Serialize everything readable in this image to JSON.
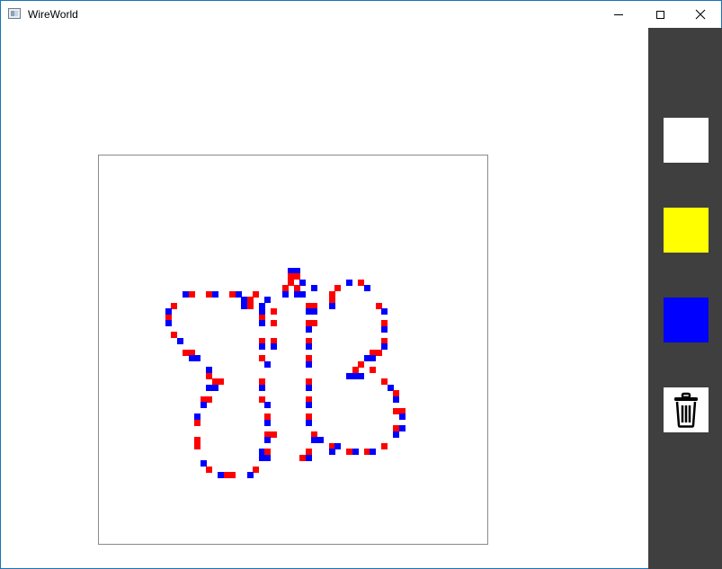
{
  "window": {
    "title": "WireWorld"
  },
  "palette": {
    "colors": {
      "empty": "#ffffff",
      "conductor": "#ffff00",
      "electron_head": "#0000ff",
      "electron_tail": "#ff0000"
    },
    "tools": [
      {
        "name": "empty-cell-tool",
        "color": "#ffffff"
      },
      {
        "name": "conductor-tool",
        "color": "#ffff00"
      },
      {
        "name": "electron-head-tool",
        "color": "#0000ff"
      },
      {
        "name": "clear-grid-tool",
        "icon": "trash-icon"
      }
    ]
  },
  "grid": {
    "cells": [
      {
        "c": "b",
        "x": 32,
        "y": 19
      },
      {
        "c": "b",
        "x": 33,
        "y": 19
      },
      {
        "c": "r",
        "x": 32,
        "y": 20
      },
      {
        "c": "r",
        "x": 33,
        "y": 20
      },
      {
        "c": "r",
        "x": 32,
        "y": 21
      },
      {
        "c": "b",
        "x": 34,
        "y": 21
      },
      {
        "c": "r",
        "x": 31,
        "y": 22
      },
      {
        "c": "r",
        "x": 33,
        "y": 22
      },
      {
        "c": "b",
        "x": 31,
        "y": 23
      },
      {
        "c": "b",
        "x": 33,
        "y": 23
      },
      {
        "c": "b",
        "x": 34,
        "y": 23
      },
      {
        "c": "b",
        "x": 42,
        "y": 21
      },
      {
        "c": "r",
        "x": 44,
        "y": 21
      },
      {
        "c": "b",
        "x": 45,
        "y": 22
      },
      {
        "c": "r",
        "x": 40,
        "y": 22
      },
      {
        "c": "b",
        "x": 36,
        "y": 22
      },
      {
        "c": "r",
        "x": 39,
        "y": 23
      },
      {
        "c": "b",
        "x": 14,
        "y": 23
      },
      {
        "c": "r",
        "x": 15,
        "y": 23
      },
      {
        "c": "r",
        "x": 18,
        "y": 23
      },
      {
        "c": "b",
        "x": 19,
        "y": 23
      },
      {
        "c": "r",
        "x": 22,
        "y": 23
      },
      {
        "c": "b",
        "x": 23,
        "y": 23
      },
      {
        "c": "r",
        "x": 26,
        "y": 23
      },
      {
        "c": "b",
        "x": 24,
        "y": 24
      },
      {
        "c": "r",
        "x": 25,
        "y": 24
      },
      {
        "c": "b",
        "x": 28,
        "y": 24
      },
      {
        "c": "b",
        "x": 24,
        "y": 25
      },
      {
        "c": "r",
        "x": 25,
        "y": 25
      },
      {
        "c": "b",
        "x": 27,
        "y": 25
      },
      {
        "c": "r",
        "x": 35,
        "y": 25
      },
      {
        "c": "r",
        "x": 36,
        "y": 25
      },
      {
        "c": "r",
        "x": 39,
        "y": 24
      },
      {
        "c": "b",
        "x": 39,
        "y": 25
      },
      {
        "c": "r",
        "x": 12,
        "y": 25
      },
      {
        "c": "b",
        "x": 11,
        "y": 26
      },
      {
        "c": "b",
        "x": 27,
        "y": 26
      },
      {
        "c": "r",
        "x": 29,
        "y": 26
      },
      {
        "c": "b",
        "x": 35,
        "y": 26
      },
      {
        "c": "b",
        "x": 36,
        "y": 26
      },
      {
        "c": "r",
        "x": 47,
        "y": 25
      },
      {
        "c": "b",
        "x": 48,
        "y": 26
      },
      {
        "c": "r",
        "x": 11,
        "y": 27
      },
      {
        "c": "b",
        "x": 11,
        "y": 28
      },
      {
        "c": "r",
        "x": 27,
        "y": 27
      },
      {
        "c": "b",
        "x": 27,
        "y": 28
      },
      {
        "c": "r",
        "x": 29,
        "y": 28
      },
      {
        "c": "r",
        "x": 35,
        "y": 28
      },
      {
        "c": "r",
        "x": 36,
        "y": 28
      },
      {
        "c": "b",
        "x": 35,
        "y": 29
      },
      {
        "c": "r",
        "x": 48,
        "y": 28
      },
      {
        "c": "b",
        "x": 48,
        "y": 29
      },
      {
        "c": "r",
        "x": 12,
        "y": 30
      },
      {
        "c": "b",
        "x": 13,
        "y": 31
      },
      {
        "c": "r",
        "x": 27,
        "y": 31
      },
      {
        "c": "b",
        "x": 27,
        "y": 32
      },
      {
        "c": "r",
        "x": 29,
        "y": 31
      },
      {
        "c": "b",
        "x": 29,
        "y": 32
      },
      {
        "c": "r",
        "x": 35,
        "y": 31
      },
      {
        "c": "b",
        "x": 35,
        "y": 32
      },
      {
        "c": "r",
        "x": 48,
        "y": 31
      },
      {
        "c": "b",
        "x": 48,
        "y": 32
      },
      {
        "c": "r",
        "x": 14,
        "y": 33
      },
      {
        "c": "r",
        "x": 15,
        "y": 33
      },
      {
        "c": "b",
        "x": 15,
        "y": 34
      },
      {
        "c": "b",
        "x": 16,
        "y": 34
      },
      {
        "c": "r",
        "x": 47,
        "y": 33
      },
      {
        "c": "r",
        "x": 46,
        "y": 33
      },
      {
        "c": "b",
        "x": 45,
        "y": 34
      },
      {
        "c": "b",
        "x": 46,
        "y": 34
      },
      {
        "c": "r",
        "x": 27,
        "y": 34
      },
      {
        "c": "b",
        "x": 28,
        "y": 35
      },
      {
        "c": "r",
        "x": 35,
        "y": 34
      },
      {
        "c": "b",
        "x": 35,
        "y": 35
      },
      {
        "c": "b",
        "x": 18,
        "y": 36
      },
      {
        "c": "r",
        "x": 18,
        "y": 37
      },
      {
        "c": "r",
        "x": 44,
        "y": 35
      },
      {
        "c": "r",
        "x": 43,
        "y": 36
      },
      {
        "c": "b",
        "x": 44,
        "y": 37
      },
      {
        "c": "b",
        "x": 42,
        "y": 37
      },
      {
        "c": "b",
        "x": 43,
        "y": 37
      },
      {
        "c": "r",
        "x": 46,
        "y": 36
      },
      {
        "c": "r",
        "x": 48,
        "y": 38
      },
      {
        "c": "r",
        "x": 19,
        "y": 38
      },
      {
        "c": "r",
        "x": 20,
        "y": 38
      },
      {
        "c": "b",
        "x": 18,
        "y": 39
      },
      {
        "c": "b",
        "x": 19,
        "y": 39
      },
      {
        "c": "r",
        "x": 27,
        "y": 38
      },
      {
        "c": "b",
        "x": 27,
        "y": 39
      },
      {
        "c": "r",
        "x": 35,
        "y": 38
      },
      {
        "c": "b",
        "x": 35,
        "y": 39
      },
      {
        "c": "b",
        "x": 49,
        "y": 39
      },
      {
        "c": "r",
        "x": 17,
        "y": 41
      },
      {
        "c": "r",
        "x": 18,
        "y": 41
      },
      {
        "c": "b",
        "x": 17,
        "y": 42
      },
      {
        "c": "r",
        "x": 27,
        "y": 41
      },
      {
        "c": "b",
        "x": 28,
        "y": 42
      },
      {
        "c": "r",
        "x": 35,
        "y": 41
      },
      {
        "c": "b",
        "x": 35,
        "y": 42
      },
      {
        "c": "r",
        "x": 50,
        "y": 40
      },
      {
        "c": "b",
        "x": 50,
        "y": 41
      },
      {
        "c": "r",
        "x": 50,
        "y": 43
      },
      {
        "c": "r",
        "x": 51,
        "y": 43
      },
      {
        "c": "b",
        "x": 16,
        "y": 44
      },
      {
        "c": "r",
        "x": 16,
        "y": 45
      },
      {
        "c": "r",
        "x": 28,
        "y": 44
      },
      {
        "c": "b",
        "x": 28,
        "y": 45
      },
      {
        "c": "r",
        "x": 35,
        "y": 44
      },
      {
        "c": "b",
        "x": 35,
        "y": 45
      },
      {
        "c": "b",
        "x": 51,
        "y": 44
      },
      {
        "c": "r",
        "x": 28,
        "y": 47
      },
      {
        "c": "r",
        "x": 29,
        "y": 47
      },
      {
        "c": "b",
        "x": 28,
        "y": 48
      },
      {
        "c": "r",
        "x": 36,
        "y": 47
      },
      {
        "c": "b",
        "x": 36,
        "y": 48
      },
      {
        "c": "b",
        "x": 37,
        "y": 48
      },
      {
        "c": "r",
        "x": 50,
        "y": 46
      },
      {
        "c": "b",
        "x": 51,
        "y": 46
      },
      {
        "c": "b",
        "x": 50,
        "y": 47
      },
      {
        "c": "r",
        "x": 16,
        "y": 48
      },
      {
        "c": "r",
        "x": 16,
        "y": 49
      },
      {
        "c": "r",
        "x": 39,
        "y": 49
      },
      {
        "c": "b",
        "x": 39,
        "y": 50
      },
      {
        "c": "b",
        "x": 40,
        "y": 49
      },
      {
        "c": "r",
        "x": 42,
        "y": 50
      },
      {
        "c": "b",
        "x": 43,
        "y": 50
      },
      {
        "c": "r",
        "x": 45,
        "y": 50
      },
      {
        "c": "b",
        "x": 46,
        "y": 50
      },
      {
        "c": "r",
        "x": 48,
        "y": 49
      },
      {
        "c": "b",
        "x": 27,
        "y": 50
      },
      {
        "c": "r",
        "x": 28,
        "y": 50
      },
      {
        "c": "b",
        "x": 28,
        "y": 51
      },
      {
        "c": "b",
        "x": 27,
        "y": 51
      },
      {
        "c": "r",
        "x": 35,
        "y": 50
      },
      {
        "c": "b",
        "x": 35,
        "y": 51
      },
      {
        "c": "r",
        "x": 34,
        "y": 51
      },
      {
        "c": "b",
        "x": 17,
        "y": 52
      },
      {
        "c": "r",
        "x": 18,
        "y": 53
      },
      {
        "c": "r",
        "x": 26,
        "y": 53
      },
      {
        "c": "b",
        "x": 20,
        "y": 54
      },
      {
        "c": "r",
        "x": 21,
        "y": 54
      },
      {
        "c": "r",
        "x": 22,
        "y": 54
      },
      {
        "c": "b",
        "x": 25,
        "y": 54
      }
    ]
  }
}
